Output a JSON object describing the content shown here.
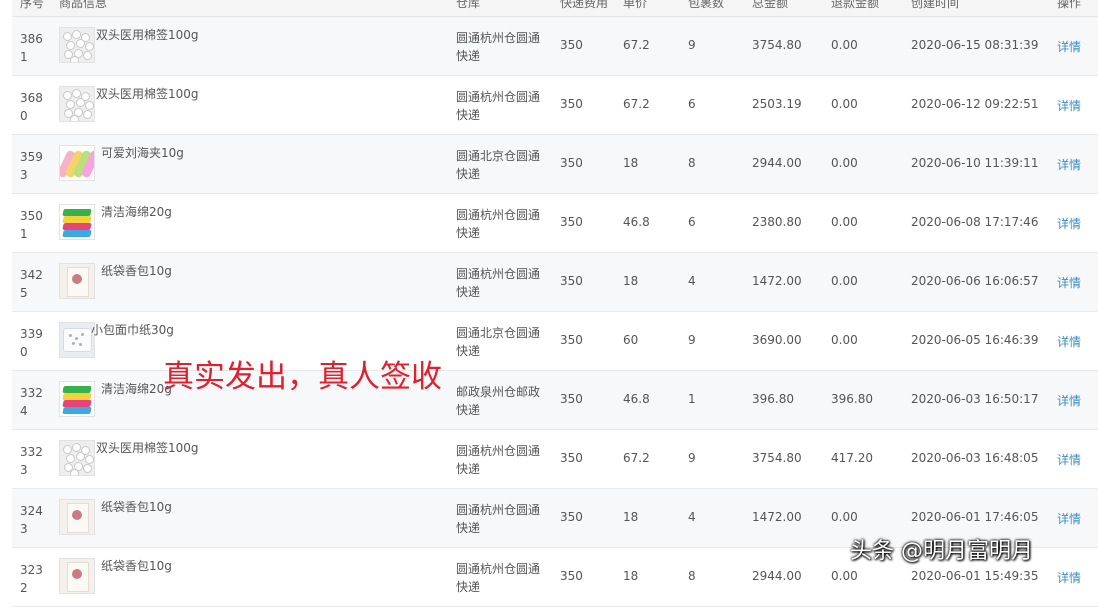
{
  "header": {
    "columns": [
      "序号",
      "商品信息",
      "仓库",
      "快递费用",
      "单价",
      "包裹数",
      "总金额",
      "退款金额",
      "创建时间",
      "操作"
    ]
  },
  "rows": [
    {
      "id": "3861",
      "product": "双头医用棉签100g",
      "thumb": "swab",
      "warehouse": "圆通杭州仓圆通快递",
      "fee": "350",
      "price": "67.2",
      "qty": "9",
      "total": "3754.80",
      "refund": "0.00",
      "time": "2020-06-15 08:31:39",
      "action": "详情"
    },
    {
      "id": "3680",
      "product": "双头医用棉签100g",
      "thumb": "swab",
      "warehouse": "圆通杭州仓圆通快递",
      "fee": "350",
      "price": "67.2",
      "qty": "6",
      "total": "2503.19",
      "refund": "0.00",
      "time": "2020-06-12 09:22:51",
      "action": "详情"
    },
    {
      "id": "3593",
      "product": "可爱刘海夹10g",
      "thumb": "clip",
      "warehouse": "圆通北京仓圆通快递",
      "fee": "350",
      "price": "18",
      "qty": "8",
      "total": "2944.00",
      "refund": "0.00",
      "time": "2020-06-10 11:39:11",
      "action": "详情"
    },
    {
      "id": "3501",
      "product": "清洁海绵20g",
      "thumb": "sponge",
      "warehouse": "圆通杭州仓圆通快递",
      "fee": "350",
      "price": "46.8",
      "qty": "6",
      "total": "2380.80",
      "refund": "0.00",
      "time": "2020-06-08 17:17:46",
      "action": "详情"
    },
    {
      "id": "3425",
      "product": "纸袋香包10g",
      "thumb": "bag",
      "warehouse": "圆通杭州仓圆通快递",
      "fee": "350",
      "price": "18",
      "qty": "4",
      "total": "1472.00",
      "refund": "0.00",
      "time": "2020-06-06 16:06:57",
      "action": "详情"
    },
    {
      "id": "3390",
      "product": "小包面巾纸30g",
      "thumb": "tissue",
      "warehouse": "圆通北京仓圆通快递",
      "fee": "350",
      "price": "60",
      "qty": "9",
      "total": "3690.00",
      "refund": "0.00",
      "time": "2020-06-05 16:46:39",
      "action": "详情"
    },
    {
      "id": "3324",
      "product": "清洁海绵20g",
      "thumb": "sponge",
      "warehouse": "邮政泉州仓邮政快递",
      "fee": "350",
      "price": "46.8",
      "qty": "1",
      "total": "396.80",
      "refund": "396.80",
      "time": "2020-06-03 16:50:17",
      "action": "详情"
    },
    {
      "id": "3323",
      "product": "双头医用棉签100g",
      "thumb": "swab",
      "warehouse": "圆通杭州仓圆通快递",
      "fee": "350",
      "price": "67.2",
      "qty": "9",
      "total": "3754.80",
      "refund": "417.20",
      "time": "2020-06-03 16:48:05",
      "action": "详情"
    },
    {
      "id": "3243",
      "product": "纸袋香包10g",
      "thumb": "bag",
      "warehouse": "圆通杭州仓圆通快递",
      "fee": "350",
      "price": "18",
      "qty": "4",
      "total": "1472.00",
      "refund": "0.00",
      "time": "2020-06-01 17:46:05",
      "action": "详情"
    },
    {
      "id": "3232",
      "product": "纸袋香包10g",
      "thumb": "bag",
      "warehouse": "圆通杭州仓圆通快递",
      "fee": "350",
      "price": "18",
      "qty": "8",
      "total": "2944.00",
      "refund": "0.00",
      "time": "2020-06-01 15:49:35",
      "action": "详情"
    }
  ],
  "overlay_text": "真实发出，真人签收",
  "watermark": "头条 @明月富明月"
}
